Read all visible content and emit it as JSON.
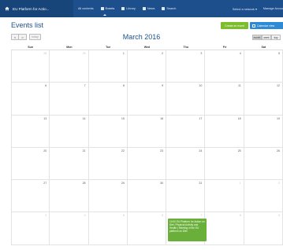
{
  "topbar": {
    "brand": "EU Platform for Actio...",
    "nav": [
      {
        "label": "All contents",
        "icon": "list-icon"
      },
      {
        "label": "Events",
        "icon": "calendar-icon"
      },
      {
        "label": "Library",
        "icon": "document-icon"
      },
      {
        "label": "News",
        "icon": "news-icon"
      },
      {
        "label": "Search",
        "icon": "search-icon"
      }
    ],
    "select_network": "Select a network ▾",
    "manage": "Manage Accou"
  },
  "header": {
    "title": "Events list",
    "create_button": "Create an event",
    "calendar_view": "Calendar view"
  },
  "toolbar": {
    "prev": "<",
    "next": ">",
    "today": "today",
    "month_title": "March 2016",
    "views": [
      "month",
      "week",
      "day"
    ]
  },
  "calendar": {
    "days_of_week": [
      "Sun",
      "Mon",
      "Tue",
      "Wed",
      "Thu",
      "Fri",
      "Sat"
    ],
    "weeks": [
      [
        "28",
        "29",
        "1",
        "2",
        "3",
        "4",
        "5"
      ],
      [
        "6",
        "7",
        "8",
        "9",
        "10",
        "11",
        "12"
      ],
      [
        "13",
        "14",
        "15",
        "16",
        "17",
        "18",
        "19"
      ],
      [
        "20",
        "21",
        "22",
        "23",
        "24",
        "25",
        "26"
      ],
      [
        "27",
        "28",
        "29",
        "30",
        "31",
        "1",
        "2"
      ],
      [
        "3",
        "4",
        "5",
        "6",
        "7",
        "8",
        "9"
      ]
    ],
    "event": {
      "text": "10:00 EU Platform for Action on Diet, Physical Activity and Health | Meeting of the EU platform on Diet"
    }
  },
  "colors": {
    "topbar": "#1d4f8c",
    "create": "#7cbd2b",
    "calendar_view": "#2d8ad5",
    "event": "#6aaf3a"
  }
}
